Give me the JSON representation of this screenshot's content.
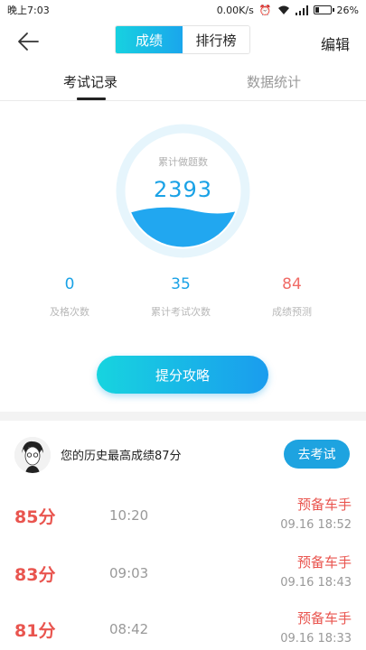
{
  "status_bar": {
    "time": "晚上7:03",
    "network_speed": "0.00K/s",
    "battery": "26%",
    "battery_level": 0.26
  },
  "header": {
    "segments": [
      {
        "label": "成绩",
        "active": true
      },
      {
        "label": "排行榜",
        "active": false
      }
    ],
    "edit_label": "编辑"
  },
  "tabs": [
    {
      "label": "考试记录",
      "active": true
    },
    {
      "label": "数据统计",
      "active": false
    }
  ],
  "summary": {
    "gauge_label": "累计做题数",
    "gauge_value": "2393",
    "stats": [
      {
        "value": "0",
        "label": "及格次数"
      },
      {
        "value": "35",
        "label": "累计考试次数"
      },
      {
        "value": "84",
        "label": "成绩预测"
      }
    ],
    "tips_button": "提分攻略"
  },
  "best": {
    "text": "您的历史最高成绩87分",
    "go_button": "去考试"
  },
  "records": [
    {
      "score": "85分",
      "duration": "10:20",
      "level": "预备车手",
      "time": "09.16  18:52"
    },
    {
      "score": "83分",
      "duration": "09:03",
      "level": "预备车手",
      "time": "09.16  18:43"
    },
    {
      "score": "81分",
      "duration": "08:42",
      "level": "预备车手",
      "time": "09.16  18:33"
    }
  ],
  "colors": {
    "accent": "#1aa2e6",
    "score_red": "#e9554f",
    "predict_red": "#f06b66"
  }
}
